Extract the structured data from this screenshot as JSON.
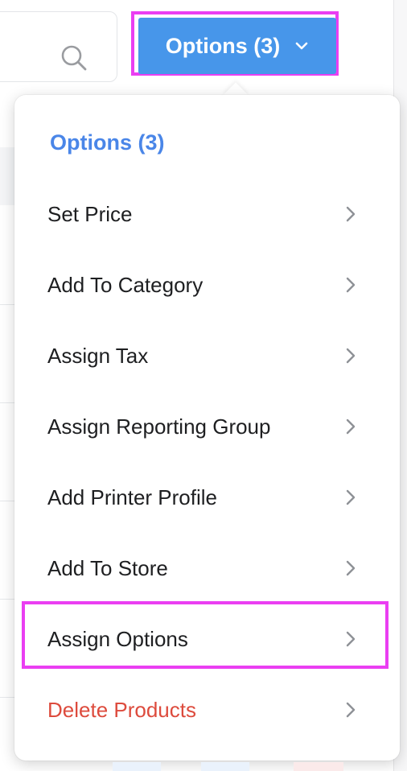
{
  "search": {
    "icon": "search-icon"
  },
  "options_button": {
    "label": "Options (3)",
    "icon": "chevron-down-icon",
    "color": "#4796ea"
  },
  "dropdown": {
    "title": "Options (3)",
    "title_color": "#4a86e8",
    "items": [
      {
        "label": "Set Price",
        "icon": "chevron-right-icon"
      },
      {
        "label": "Add To Category",
        "icon": "chevron-right-icon"
      },
      {
        "label": "Assign Tax",
        "icon": "chevron-right-icon"
      },
      {
        "label": "Assign Reporting Group",
        "icon": "chevron-right-icon"
      },
      {
        "label": "Add Printer Profile",
        "icon": "chevron-right-icon"
      },
      {
        "label": "Add To Store",
        "icon": "chevron-right-icon"
      },
      {
        "label": "Assign Options",
        "icon": "chevron-right-icon"
      },
      {
        "label": "Delete Products",
        "icon": "chevron-right-icon",
        "color": "#dd4b3d"
      }
    ]
  },
  "highlight_color": "#ea3ef2"
}
